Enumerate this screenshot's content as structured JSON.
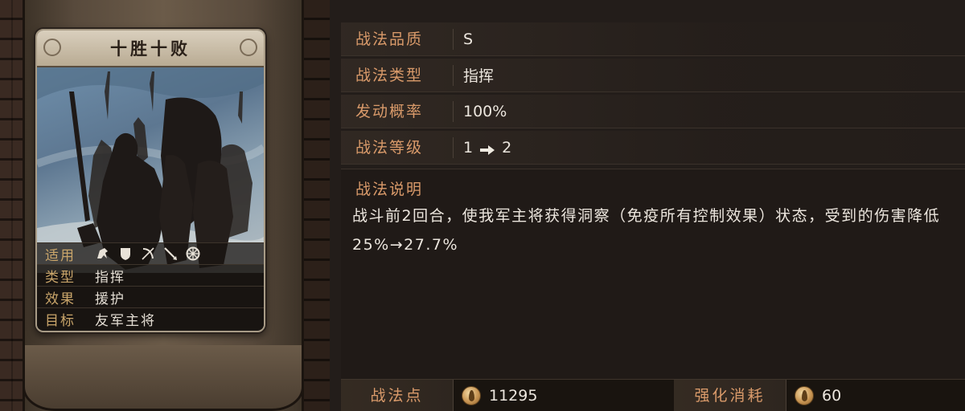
{
  "card": {
    "title": "十胜十败",
    "attributes": [
      {
        "label": "适用",
        "value": "",
        "icons": [
          "cavalry-icon",
          "shield-icon",
          "archer-icon",
          "spear-icon",
          "siege-icon"
        ]
      },
      {
        "label": "类型",
        "value": "指挥"
      },
      {
        "label": "效果",
        "value": "援护"
      },
      {
        "label": "目标",
        "value": "友军主将"
      }
    ]
  },
  "info": {
    "quality": {
      "label": "战法品质",
      "value": "S"
    },
    "type": {
      "label": "战法类型",
      "value": "指挥"
    },
    "trigger_rate": {
      "label": "发动概率",
      "value": "100%"
    },
    "level": {
      "label": "战法等级",
      "from": "1",
      "to": "2"
    }
  },
  "description": {
    "title": "战法说明",
    "text": "战斗前2回合，使我军主将获得洞察（免疫所有控制效果）状态，受到的伤害降低25%→27.7%"
  },
  "bottom": {
    "tactic_points": {
      "label": "战法点",
      "value": "11295"
    },
    "upgrade_cost": {
      "label": "强化消耗",
      "value": "60"
    }
  },
  "colors": {
    "label_orange": "#d99a6a",
    "card_label_gold": "#c9a56a",
    "text_light": "#ece6de"
  }
}
